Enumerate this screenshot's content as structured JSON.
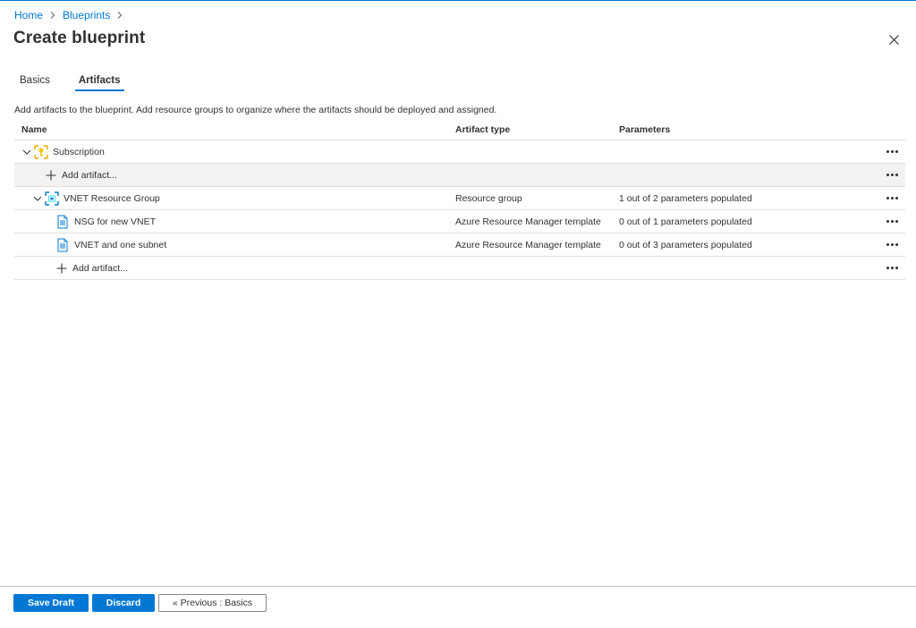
{
  "breadcrumb": {
    "home": "Home",
    "blueprints": "Blueprints"
  },
  "page": {
    "title": "Create blueprint"
  },
  "tabs": [
    {
      "label": "Basics",
      "active": false
    },
    {
      "label": "Artifacts",
      "active": true
    }
  ],
  "description": "Add artifacts to the blueprint. Add resource groups to organize where the artifacts should be deployed and assigned.",
  "grid": {
    "columns": {
      "name": "Name",
      "type": "Artifact type",
      "params": "Parameters"
    },
    "rows": [
      {
        "name": "Subscription",
        "type": "",
        "params": "",
        "icon": "subscription-key-icon",
        "expanded": true
      },
      {
        "name": "Add artifact...",
        "type": "",
        "params": "",
        "icon": "plus-icon",
        "selected": true
      },
      {
        "name": "VNET Resource Group",
        "type": "Resource group",
        "params": "1 out of 2 parameters populated",
        "icon": "resource-group-icon",
        "expanded": true
      },
      {
        "name": "NSG for new VNET",
        "type": "Azure Resource Manager template",
        "params": "0 out of 1 parameters populated",
        "icon": "template-icon"
      },
      {
        "name": "VNET and one subnet",
        "type": "Azure Resource Manager template",
        "params": "0 out of 3 parameters populated",
        "icon": "template-icon"
      },
      {
        "name": "Add artifact...",
        "type": "",
        "params": "",
        "icon": "plus-icon"
      }
    ]
  },
  "footer": {
    "save_draft": "Save Draft",
    "discard": "Discard",
    "previous": "« Previous : Basics"
  },
  "colors": {
    "accent": "#0078d4",
    "text": "#323130",
    "border": "#e1dfdd"
  }
}
